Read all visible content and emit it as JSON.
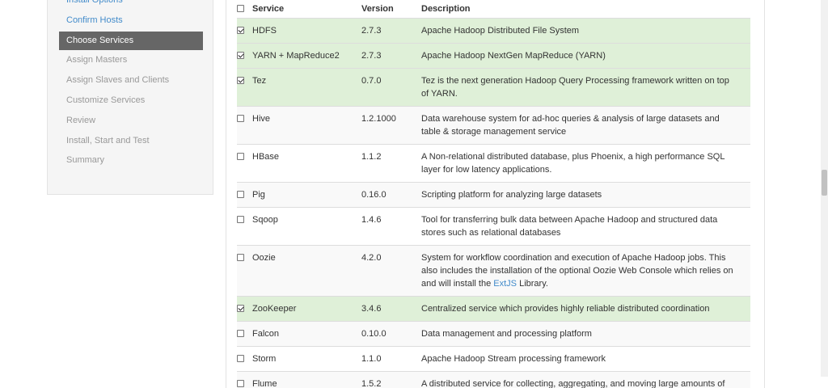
{
  "sidebar": {
    "items": [
      {
        "label": "Install Options",
        "state": "done"
      },
      {
        "label": "Confirm Hosts",
        "state": "done"
      },
      {
        "label": "Choose Services",
        "state": "active"
      },
      {
        "label": "Assign Masters",
        "state": "pending"
      },
      {
        "label": "Assign Slaves and Clients",
        "state": "pending"
      },
      {
        "label": "Customize Services",
        "state": "pending"
      },
      {
        "label": "Review",
        "state": "pending"
      },
      {
        "label": "Install, Start and Test",
        "state": "pending"
      },
      {
        "label": "Summary",
        "state": "pending"
      }
    ]
  },
  "table": {
    "headers": {
      "service": "Service",
      "version": "Version",
      "description": "Description"
    },
    "select_all_checked": false,
    "rows": [
      {
        "name": "HDFS",
        "version": "2.7.3",
        "checked": true,
        "description": "Apache Hadoop Distributed File System"
      },
      {
        "name": "YARN + MapReduce2",
        "version": "2.7.3",
        "checked": true,
        "description": "Apache Hadoop NextGen MapReduce (YARN)"
      },
      {
        "name": "Tez",
        "version": "0.7.0",
        "checked": true,
        "description": "Tez is the next generation Hadoop Query Processing framework written on top of YARN."
      },
      {
        "name": "Hive",
        "version": "1.2.1000",
        "checked": false,
        "description": "Data warehouse system for ad-hoc queries & analysis of large datasets and table & storage management service"
      },
      {
        "name": "HBase",
        "version": "1.1.2",
        "checked": false,
        "description": "A Non-relational distributed database, plus Phoenix, a high performance SQL layer for low latency applications."
      },
      {
        "name": "Pig",
        "version": "0.16.0",
        "checked": false,
        "description": "Scripting platform for analyzing large datasets"
      },
      {
        "name": "Sqoop",
        "version": "1.4.6",
        "checked": false,
        "description": "Tool for transferring bulk data between Apache Hadoop and structured data stores such as relational databases"
      },
      {
        "name": "Oozie",
        "version": "4.2.0",
        "checked": false,
        "description": "System for workflow coordination and execution of Apache Hadoop jobs. This also includes the installation of the optional Oozie Web Console which relies on and will install the ",
        "link": "ExtJS",
        "description_after": " Library."
      },
      {
        "name": "ZooKeeper",
        "version": "3.4.6",
        "checked": true,
        "description": "Centralized service which provides highly reliable distributed coordination"
      },
      {
        "name": "Falcon",
        "version": "0.10.0",
        "checked": false,
        "description": "Data management and processing platform"
      },
      {
        "name": "Storm",
        "version": "1.1.0",
        "checked": false,
        "description": "Apache Hadoop Stream processing framework"
      },
      {
        "name": "Flume",
        "version": "1.5.2",
        "checked": false,
        "description": "A distributed service for collecting, aggregating, and moving large amounts of"
      }
    ]
  },
  "colors": {
    "selected_row": "#dff0d8",
    "link": "#428bca",
    "active_nav": "#666666"
  }
}
